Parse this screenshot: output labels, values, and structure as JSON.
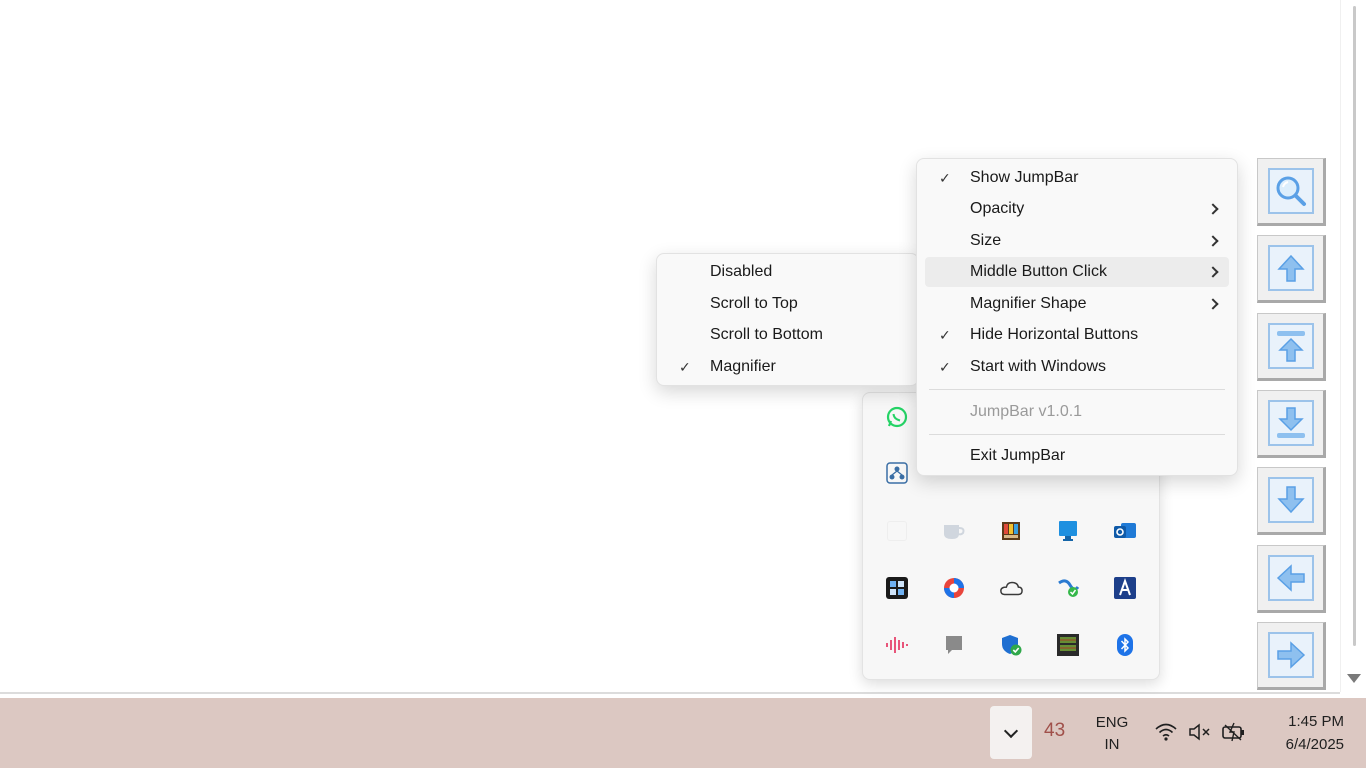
{
  "main_menu": {
    "items": [
      {
        "label": "Show JumpBar",
        "checked": true,
        "submenu": false
      },
      {
        "label": "Opacity",
        "checked": false,
        "submenu": true
      },
      {
        "label": "Size",
        "checked": false,
        "submenu": true
      },
      {
        "label": "Middle Button Click",
        "checked": false,
        "submenu": true,
        "highlighted": true
      },
      {
        "label": "Magnifier Shape",
        "checked": false,
        "submenu": true
      },
      {
        "label": "Hide Horizontal Buttons",
        "checked": true,
        "submenu": false
      },
      {
        "label": "Start with Windows",
        "checked": true,
        "submenu": false
      }
    ],
    "version_label": "JumpBar v1.0.1",
    "exit_label": "Exit JumpBar",
    "check_glyph": "✓"
  },
  "sub_menu": {
    "items": [
      {
        "label": "Disabled",
        "checked": false
      },
      {
        "label": "Scroll to Top",
        "checked": false
      },
      {
        "label": "Scroll to Bottom",
        "checked": false
      },
      {
        "label": "Magnifier",
        "checked": true
      }
    ]
  },
  "jumpbar_buttons": [
    "magnifier-icon",
    "arrow-up-icon",
    "jump-to-top-icon",
    "jump-to-bottom-icon",
    "arrow-down-icon",
    "arrow-left-icon",
    "arrow-right-icon"
  ],
  "tray_icons": [
    [
      "whatsapp-icon"
    ],
    [
      "network-share-icon",
      "shield-app-icon",
      "app-icon",
      "app-icon",
      "app-icon"
    ],
    [
      "blank-icon",
      "cup-icon",
      "color-app-icon",
      "monitor-icon",
      "outlook-icon"
    ],
    [
      "tiles-app-icon",
      "chrome-like-icon",
      "onedrive-icon",
      "vpn-icon",
      "text-app-icon"
    ],
    [
      "audio-wave-icon",
      "gray-app-icon",
      "defender-icon",
      "grid-app-icon",
      "bluetooth-icon"
    ]
  ],
  "taskbar": {
    "temperature": "43",
    "lang_line1": "ENG",
    "lang_line2": "IN",
    "time": "1:45 PM",
    "date": "6/4/2025"
  },
  "colors": {
    "accent_blue": "#5aa0e6",
    "taskbar_bg": "#dcc8c2"
  }
}
